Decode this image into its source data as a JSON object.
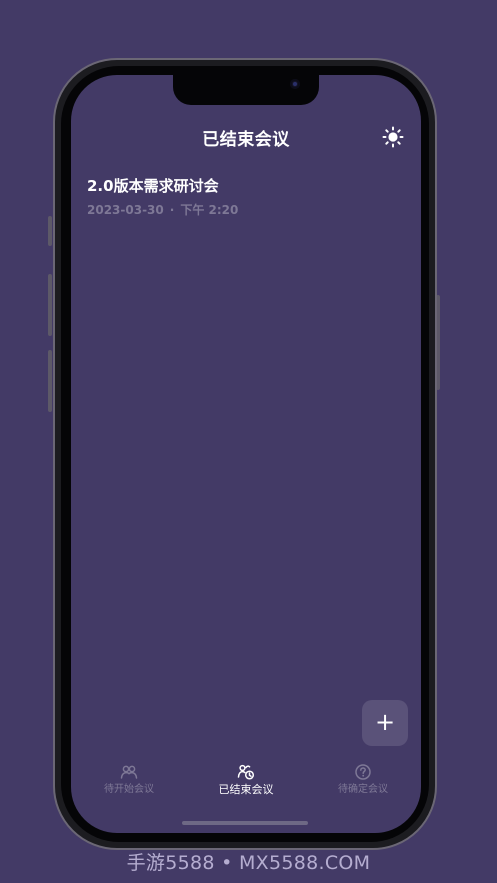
{
  "header": {
    "title": "已结束会议",
    "theme_icon": "sun-icon"
  },
  "meetings": [
    {
      "title": "2.0版本需求研讨会",
      "date": "2023-03-30",
      "separator": "·",
      "time": "下午 2:20"
    }
  ],
  "fab": {
    "label": "+",
    "icon": "plus-icon"
  },
  "tabs": [
    {
      "label": "待开始会议",
      "icon": "people-icon",
      "active": false
    },
    {
      "label": "已结束会议",
      "icon": "ended-meeting-icon",
      "active": true
    },
    {
      "label": "待确定会议",
      "icon": "question-circle-icon",
      "active": false
    }
  ],
  "watermark": "手游5588 • MX5588.COM",
  "colors": {
    "background": "#433a66",
    "fab": "#5a5279",
    "muted_text": "#7e7896",
    "text": "#ffffff"
  }
}
